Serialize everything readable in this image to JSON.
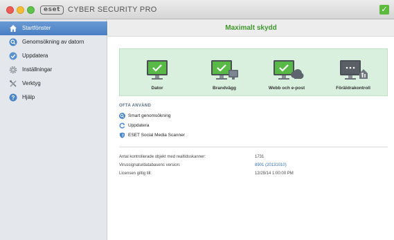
{
  "titlebar": {
    "logo_text": "eset",
    "product_name": "CYBER SECURITY PRO",
    "status_icon": "green-check",
    "status_icon_glyph": "✓"
  },
  "colors": {
    "accent_blue": "#4a7fc4",
    "status_green": "#3f9a2c",
    "panel_green": "#d9f0de",
    "link_blue": "#2f6fb6"
  },
  "sidebar": {
    "items": [
      {
        "label": "Startfönster",
        "icon": "home-icon",
        "active": true
      },
      {
        "label": "Genomsökning av datorn",
        "icon": "search-icon",
        "active": false
      },
      {
        "label": "Uppdatera",
        "icon": "update-icon",
        "active": false
      },
      {
        "label": "Inställningar",
        "icon": "gear-icon",
        "active": false
      },
      {
        "label": "Verktyg",
        "icon": "tools-icon",
        "active": false
      },
      {
        "label": "Hjälp",
        "icon": "help-icon",
        "active": false
      }
    ]
  },
  "main": {
    "title": "Maximalt skydd",
    "protection_tiles": [
      {
        "label": "Dator",
        "icon": "monitor-check-icon"
      },
      {
        "label": "Brandvägg",
        "icon": "monitor-firewall-icon"
      },
      {
        "label": "Webb och e-post",
        "icon": "monitor-cloud-icon"
      },
      {
        "label": "Föräldrakontroll",
        "icon": "monitor-parental-icon"
      }
    ],
    "often_used": {
      "title": "OFTA ANVÄND",
      "items": [
        {
          "label": "Smart genomsökning",
          "icon": "search-icon"
        },
        {
          "label": "Uppdatera",
          "icon": "update-icon"
        },
        {
          "label": "ESET Social Media Scanner",
          "icon": "shield-icon"
        }
      ]
    },
    "info": [
      {
        "label": "Antal kontrollerade objekt med realtidsskanner:",
        "value": "1731",
        "link": false
      },
      {
        "label": "Virussignaturdatabasens version:",
        "value": "8901 (20131010)",
        "link": true
      },
      {
        "label": "Licensen giltig till:",
        "value": "12/29/14 1:00:00 PM",
        "link": false
      }
    ]
  }
}
